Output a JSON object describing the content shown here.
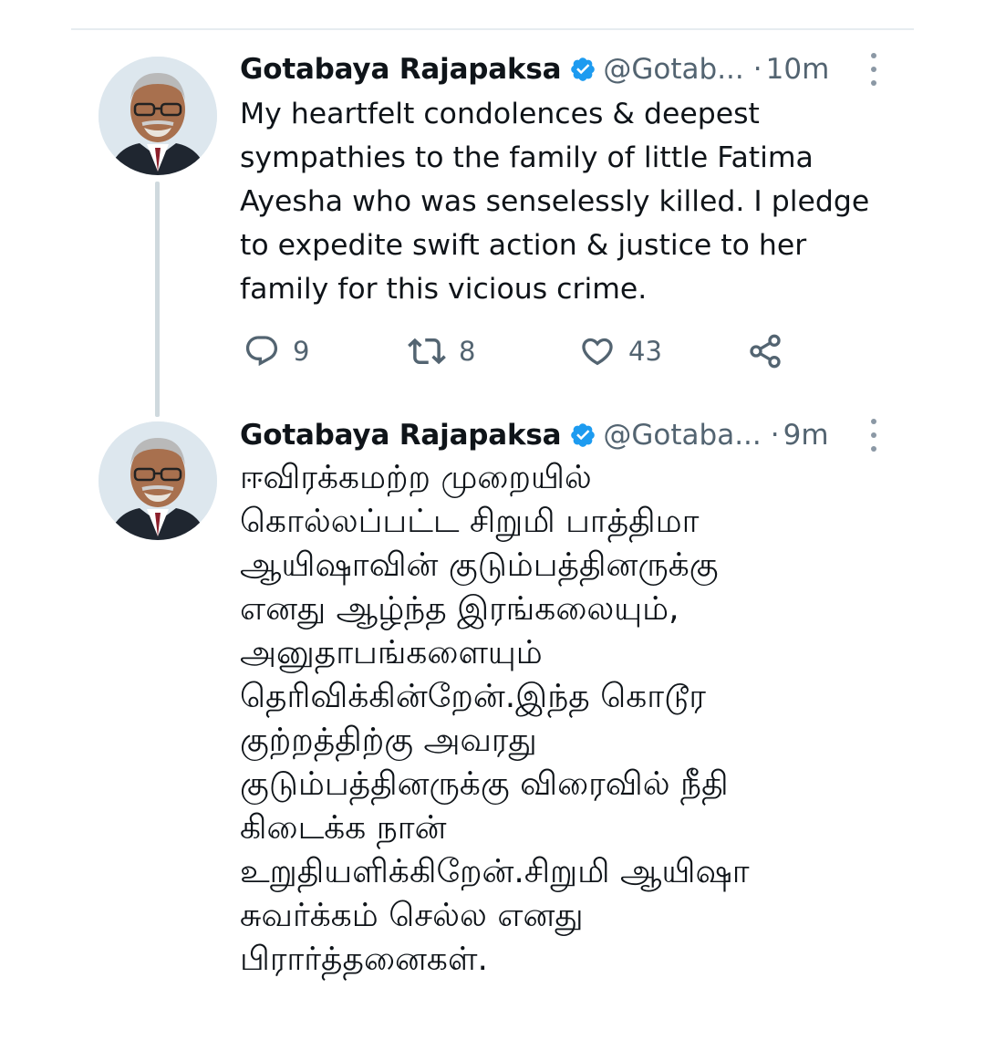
{
  "colors": {
    "verified_badge": "#1d9bf0",
    "secondary_text": "#536471",
    "thread_line": "#cfd9de",
    "icon": "#536471"
  },
  "tweets": [
    {
      "name": "Gotabaya Rajapaksa",
      "handle": "@Gotab...",
      "dot": "·",
      "time": "10m",
      "avatar_icon": "profile-photo",
      "text": "My heartfelt condolences & deepest\nsympathies to the family of little Fatima\nAyesha who was senselessly killed. I pledge\nto expedite swift action & justice to her\nfamily for this vicious crime.",
      "actions": {
        "reply_count": "9",
        "retweet_count": "8",
        "like_count": "43",
        "reply_icon": "reply-icon",
        "retweet_icon": "retweet-icon",
        "like_icon": "heart-icon",
        "share_icon": "share-icon"
      }
    },
    {
      "name": "Gotabaya Rajapaksa",
      "handle": "@Gotaba...",
      "dot": "·",
      "time": "9m",
      "avatar_icon": "profile-photo",
      "text": "ஈவிரக்கமற்ற முறையில்\nகொல்லப்பட்ட சிறுமி பாத்திமா\nஆயிஷாவின் குடும்பத்தினருக்கு\nஎனது ஆழ்ந்த இரங்கலையும்,\nஅனுதாபங்களையும்\nதெரிவிக்கின்றேன்.இந்த கொடூர\nகுற்றத்திற்கு அவரது\nகுடும்பத்தினருக்கு விரைவில் நீதி\nகிடைக்க நான்\nஉறுதியளிக்கிறேன்.சிறுமி ஆயிஷா\nசுவர்க்கம் செல்ல எனது\nபிரார்த்தனைகள்."
    }
  ]
}
